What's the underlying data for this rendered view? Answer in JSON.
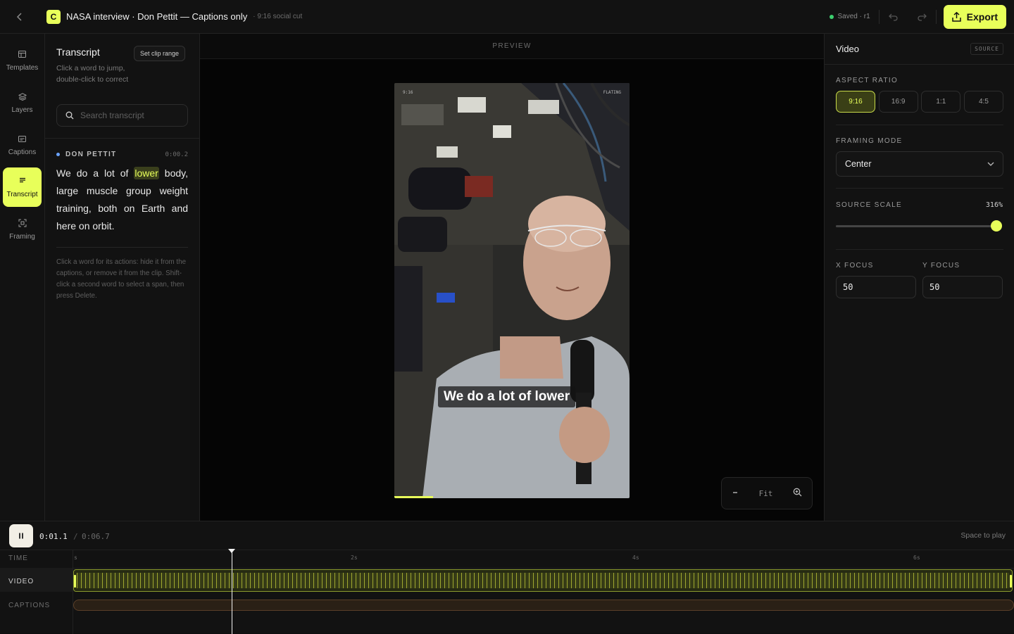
{
  "header": {
    "logo_letter": "C",
    "title": "NASA interview · Don Pettit — Captions only",
    "subtitle": "· 9:16 social cut",
    "saved": "Saved · r1",
    "export_label": "Export"
  },
  "rail": {
    "items": [
      {
        "label": "Templates",
        "icon": "templates-icon"
      },
      {
        "label": "Layers",
        "icon": "layers-icon"
      },
      {
        "label": "Captions",
        "icon": "captions-icon"
      },
      {
        "label": "Transcript",
        "icon": "transcript-icon",
        "active": true
      },
      {
        "label": "Framing",
        "icon": "framing-icon"
      }
    ]
  },
  "transcript": {
    "title": "Transcript",
    "description": "Click a word to jump, double-click to correct",
    "clip_button": "Set clip range",
    "search_placeholder": "Search transcript",
    "speaker": "DON PETTIT",
    "timestamp": "0:00.2",
    "words": [
      "We",
      "do",
      "a",
      "lot",
      "of",
      "lower",
      "body,",
      "large",
      "muscle",
      "group",
      "weight",
      "training,",
      "both",
      "on",
      "Earth",
      "and",
      "here",
      "on",
      "orbit."
    ],
    "highlighted_word_index": 5,
    "help": "Click a word for its actions: hide it from the captions, or remove it from the clip. Shift-click a second word to select a span, then press Delete."
  },
  "preview": {
    "header": "PREVIEW",
    "corner_left": "9:16",
    "corner_right": "FLATING",
    "caption": "We do a lot of lower",
    "zoom_label": "Fit",
    "progress": 0.164
  },
  "video_panel": {
    "title": "Video",
    "badge": "SOURCE",
    "aspect_label": "ASPECT RATIO",
    "aspect_options": [
      "9:16",
      "16:9",
      "1:1",
      "4:5"
    ],
    "aspect_selected": "9:16",
    "framing_label": "FRAMING MODE",
    "framing_value": "Center",
    "scale_label": "SOURCE SCALE",
    "scale_value": "316%",
    "scale_fraction": 1.0,
    "x_focus_label": "X FOCUS",
    "x_focus_value": "50",
    "y_focus_label": "Y FOCUS",
    "y_focus_value": "50"
  },
  "timeline": {
    "current": "0:01.1",
    "separator": "/",
    "total": "0:06.7",
    "hint": "Space to play",
    "labels": {
      "time": "TIME",
      "video": "VIDEO",
      "captions": "CAPTIONS"
    },
    "ticks": [
      "s",
      "2s",
      "4s",
      "6s"
    ]
  },
  "colors": {
    "accent": "#e8ff5a",
    "saved_dot": "#3ccf6e",
    "speaker_dot": "#6aa3ff"
  }
}
